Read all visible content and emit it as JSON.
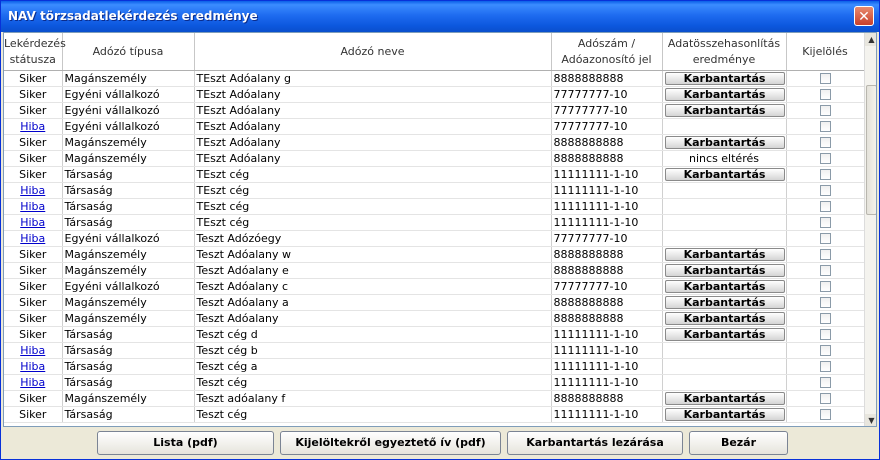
{
  "window": {
    "title": "NAV törzsadatlekérdezés eredménye",
    "close_icon": "close-icon"
  },
  "columns": [
    "Lekérdezés státusza",
    "Adózó típusa",
    "Adózó neve",
    "Adószám / Adóazonosító jel",
    "Adatösszehasonlítás eredménye",
    "Kijelölés"
  ],
  "rows": [
    {
      "status": "Siker",
      "type": "Magánszemély",
      "name": "TEszt Adóalany g",
      "id": "8888888888",
      "result": "Karbantartás"
    },
    {
      "status": "Siker",
      "type": "Egyéni vállalkozó",
      "name": "TEszt Adóalany",
      "id": "77777777-10",
      "result": "Karbantartás"
    },
    {
      "status": "Siker",
      "type": "Egyéni vállalkozó",
      "name": "TEszt Adóalany",
      "id": "77777777-10",
      "result": "Karbantartás"
    },
    {
      "status": "Hiba",
      "type": "Egyéni vállalkozó",
      "name": "TEszt Adóalany",
      "id": "77777777-10",
      "result": ""
    },
    {
      "status": "Siker",
      "type": "Magánszemély",
      "name": "TEszt Adóalany",
      "id": "8888888888",
      "result": "Karbantartás"
    },
    {
      "status": "Siker",
      "type": "Magánszemély",
      "name": "TEszt Adóalany",
      "id": "8888888888",
      "result": "nincs eltérés"
    },
    {
      "status": "Siker",
      "type": "Társaság",
      "name": "TEszt cég",
      "id": "11111111-1-10",
      "result": "Karbantartás"
    },
    {
      "status": "Hiba",
      "type": "Társaság",
      "name": "TEszt cég",
      "id": "11111111-1-10",
      "result": ""
    },
    {
      "status": "Hiba",
      "type": "Társaság",
      "name": "TEszt cég",
      "id": "11111111-1-10",
      "result": ""
    },
    {
      "status": "Hiba",
      "type": "Társaság",
      "name": "TEszt cég",
      "id": "11111111-1-10",
      "result": ""
    },
    {
      "status": "Hiba",
      "type": "Egyéni vállalkozó",
      "name": "Teszt Adózóegy",
      "id": "77777777-10",
      "result": ""
    },
    {
      "status": "Siker",
      "type": "Magánszemély",
      "name": "Teszt Adóalany w",
      "id": "8888888888",
      "result": "Karbantartás"
    },
    {
      "status": "Siker",
      "type": "Magánszemély",
      "name": "Teszt Adóalany e",
      "id": "8888888888",
      "result": "Karbantartás"
    },
    {
      "status": "Siker",
      "type": "Egyéni vállalkozó",
      "name": "Teszt Adóalany c",
      "id": "77777777-10",
      "result": "Karbantartás"
    },
    {
      "status": "Siker",
      "type": "Magánszemély",
      "name": "Teszt Adóalany a",
      "id": "8888888888",
      "result": "Karbantartás"
    },
    {
      "status": "Siker",
      "type": "Magánszemély",
      "name": "Teszt Adóalany",
      "id": "8888888888",
      "result": "Karbantartás"
    },
    {
      "status": "Siker",
      "type": "Társaság",
      "name": "Teszt cég d",
      "id": "11111111-1-10",
      "result": "Karbantartás"
    },
    {
      "status": "Hiba",
      "type": "Társaság",
      "name": "Teszt cég b",
      "id": "11111111-1-10",
      "result": ""
    },
    {
      "status": "Hiba",
      "type": "Társaság",
      "name": "Teszt cég a",
      "id": "11111111-1-10",
      "result": ""
    },
    {
      "status": "Hiba",
      "type": "Társaság",
      "name": "Teszt cég",
      "id": "11111111-1-10",
      "result": ""
    },
    {
      "status": "Siker",
      "type": "Magánszemély",
      "name": "Teszt adóalany f",
      "id": "8888888888",
      "result": "Karbantartás"
    },
    {
      "status": "Siker",
      "type": "Társaság",
      "name": "Teszt cég",
      "id": "11111111-1-10",
      "result": "Karbantartás"
    }
  ],
  "buttons": {
    "lista": "Lista (pdf)",
    "kijeloltek": "Kijelöltekről egyeztető ív (pdf)",
    "lezaras": "Karbantartás lezárása",
    "bezar": "Bezár"
  },
  "colors": {
    "titlebar": "#0a5fe8",
    "link": "#0000cc"
  }
}
